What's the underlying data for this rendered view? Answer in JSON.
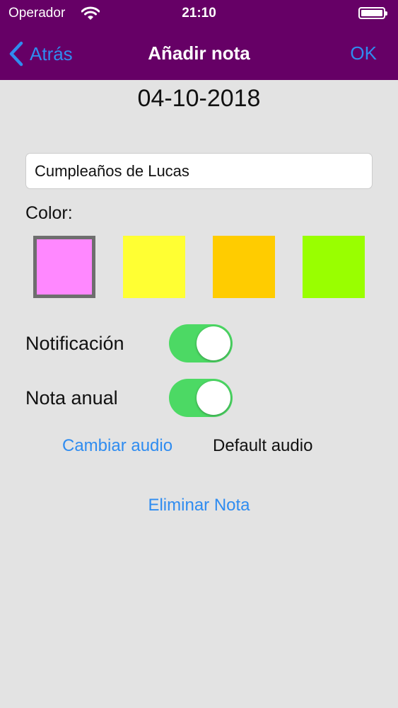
{
  "status_bar": {
    "carrier": "Operador",
    "time": "21:10",
    "wifi_icon": "wifi-icon",
    "battery_icon": "battery-icon"
  },
  "nav": {
    "back_label": "Atrás",
    "back_icon": "chevron-left-icon",
    "title": "Añadir nota",
    "ok_label": "OK",
    "bar_color": "#660066",
    "accent_color": "#2f8cf0"
  },
  "note": {
    "date": "04-10-2018",
    "name_value": "Cumpleaños de Lucas"
  },
  "color_section": {
    "label": "Color:",
    "swatches": [
      {
        "color": "#ff88ff",
        "selected": true
      },
      {
        "color": "#ffff33",
        "selected": false
      },
      {
        "color": "#ffcc00",
        "selected": false
      },
      {
        "color": "#99ff00",
        "selected": false
      }
    ]
  },
  "settings": {
    "notification_label": "Notificación",
    "notification_on": true,
    "annual_label": "Nota anual",
    "annual_on": true,
    "toggle_on_color": "#4cd964"
  },
  "audio": {
    "change_label": "Cambiar audio",
    "current": "Default audio"
  },
  "actions": {
    "delete_label": "Eliminar Nota"
  }
}
